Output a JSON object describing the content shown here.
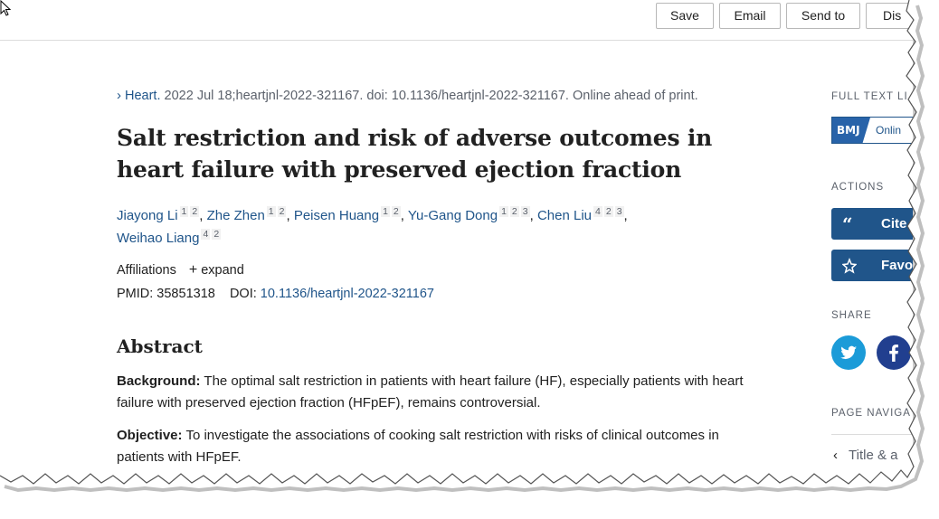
{
  "toolbar": {
    "buttons": [
      "Save",
      "Email",
      "Send to",
      "Dis"
    ]
  },
  "citation": {
    "journal": "Heart.",
    "rest": "2022 Jul 18;heartjnl-2022-321167. doi: 10.1136/heartjnl-2022-321167. Online ahead of print."
  },
  "article": {
    "title": "Salt restriction and risk of adverse outcomes in heart failure with preserved ejection fraction",
    "authors": [
      {
        "name": "Jiayong Li",
        "affs": [
          "1",
          "2"
        ]
      },
      {
        "name": "Zhe Zhen",
        "affs": [
          "1",
          "2"
        ]
      },
      {
        "name": "Peisen Huang",
        "affs": [
          "1",
          "2"
        ]
      },
      {
        "name": "Yu-Gang Dong",
        "affs": [
          "1",
          "2",
          "3"
        ]
      },
      {
        "name": "Chen Liu",
        "affs": [
          "4",
          "2",
          "3"
        ]
      },
      {
        "name": "Weihao Liang",
        "affs": [
          "4",
          "2"
        ]
      }
    ],
    "affiliations_label": "Affiliations",
    "expand_label": "expand",
    "pmid_label": "PMID: 35851318",
    "doi_label": "DOI:",
    "doi_value": "10.1136/heartjnl-2022-321167"
  },
  "abstract": {
    "heading": "Abstract",
    "background_label": "Background:",
    "background_text": "The optimal salt restriction in patients with heart failure (HF), especially patients with heart failure with preserved ejection fraction (HFpEF), remains controversial.",
    "objective_label": "Objective:",
    "objective_text": "To investigate the associations of cooking salt restriction with risks of clinical outcomes in patients with HFpEF."
  },
  "sidebar": {
    "full_text_label": "FULL TEXT LI",
    "bmj_mark": "BMJ",
    "bmj_text": "Onlin",
    "actions_label": "ACTIONS",
    "cite_label": "Cite",
    "favorites_label": "Favo",
    "share_label": "SHARE",
    "page_nav_label": "PAGE NAVIGAT",
    "page_nav_item": "Title & a"
  },
  "colors": {
    "link": "#20558a",
    "action_bg": "#20558a",
    "twitter": "#1b9bd8",
    "facebook": "#213f8f"
  }
}
